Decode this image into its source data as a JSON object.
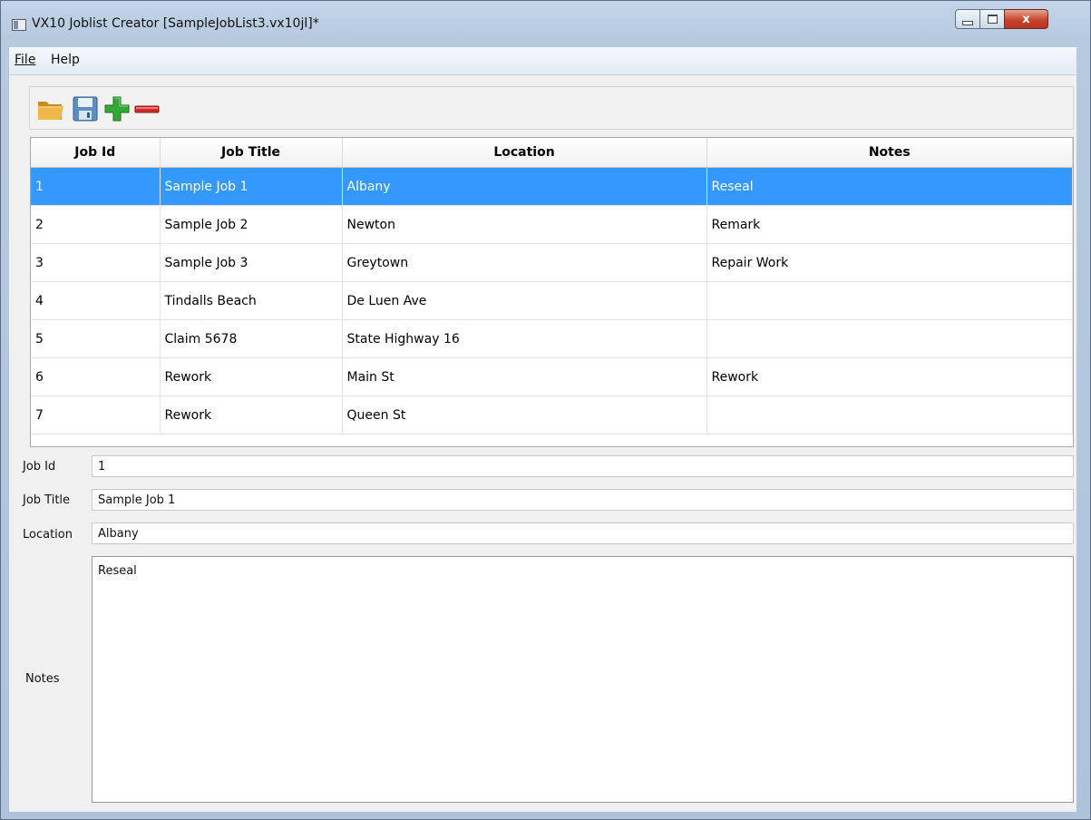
{
  "window": {
    "title": "VX10 Joblist Creator [SampleJobList3.vx10jl]*",
    "close_glyph": "x"
  },
  "menu": {
    "items": [
      "File",
      "Help"
    ]
  },
  "toolbar": {
    "icons": [
      "open-folder-icon",
      "save-icon",
      "add-icon",
      "remove-icon"
    ]
  },
  "table": {
    "columns": [
      "Job Id",
      "Job Title",
      "Location",
      "Notes"
    ],
    "selected_index": 0,
    "rows": [
      [
        "1",
        "Sample Job 1",
        "Albany",
        "Reseal"
      ],
      [
        "2",
        "Sample Job 2",
        "Newton",
        "Remark"
      ],
      [
        "3",
        "Sample Job 3",
        "Greytown",
        "Repair Work"
      ],
      [
        "4",
        "Tindalls Beach",
        "De Luen Ave",
        ""
      ],
      [
        "5",
        "Claim 5678",
        "State Highway 16",
        ""
      ],
      [
        "6",
        "Rework",
        "Main St",
        "Rework"
      ],
      [
        "7",
        "Rework",
        "Queen St",
        ""
      ]
    ]
  },
  "form": {
    "job_id_label": "Job Id",
    "job_id_value": "1",
    "job_title_label": "Job Title",
    "job_title_value": "Sample Job 1",
    "location_label": "Location",
    "location_value": "Albany",
    "notes_label": "Notes",
    "notes_value": "Reseal"
  },
  "colors": {
    "selection": "#3399ff",
    "add_icon": "#2e9e2e",
    "remove_icon": "#c62828",
    "folder_icon": "#e3a93b"
  }
}
